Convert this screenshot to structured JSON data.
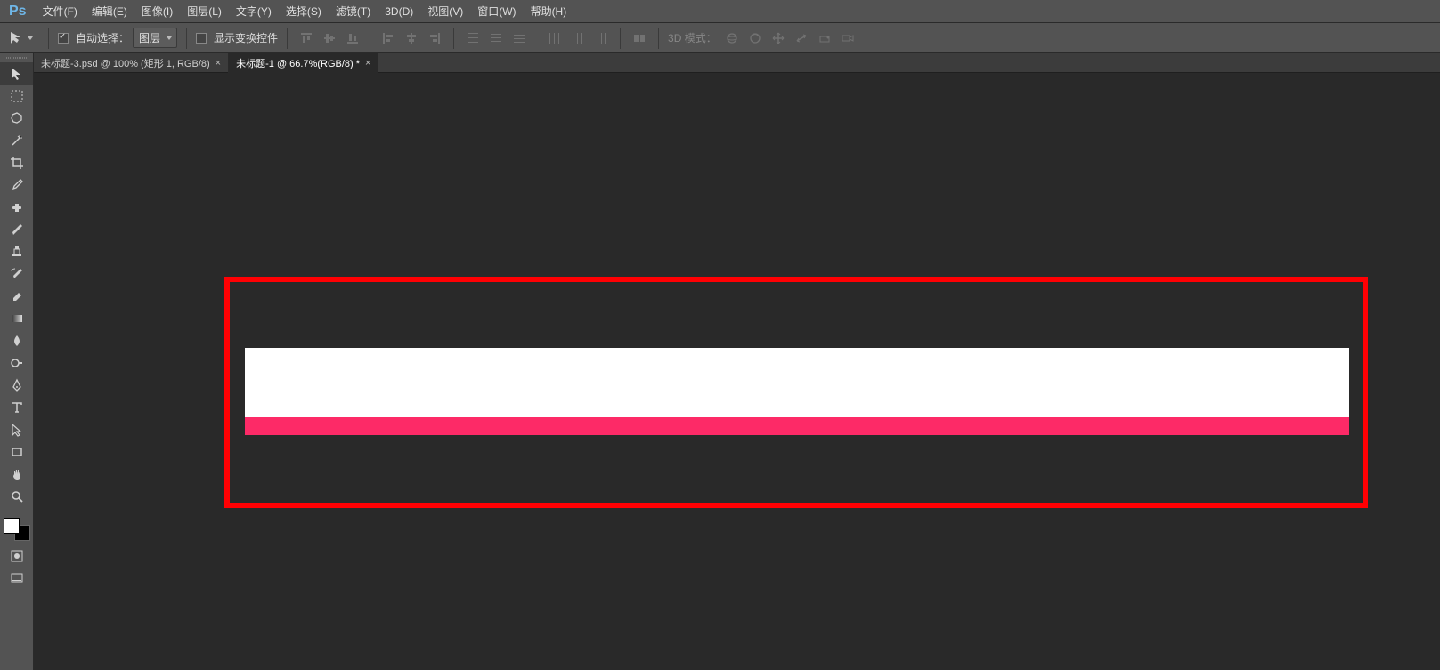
{
  "app": {
    "logo": "Ps"
  },
  "menu": {
    "items": [
      {
        "label": "文件(F)"
      },
      {
        "label": "编辑(E)"
      },
      {
        "label": "图像(I)"
      },
      {
        "label": "图层(L)"
      },
      {
        "label": "文字(Y)"
      },
      {
        "label": "选择(S)"
      },
      {
        "label": "滤镜(T)"
      },
      {
        "label": "3D(D)"
      },
      {
        "label": "视图(V)"
      },
      {
        "label": "窗口(W)"
      },
      {
        "label": "帮助(H)"
      }
    ]
  },
  "options": {
    "auto_select_label": "自动选择：",
    "auto_select_dropdown": "图层",
    "show_transform_label": "显示变换控件",
    "mode_3d_label": "3D 模式："
  },
  "tabs": {
    "items": [
      {
        "label": "未标题-3.psd @ 100% (矩形 1, RGB/8)",
        "close": "×"
      },
      {
        "label": "未标题-1 @ 66.7%(RGB/8) *",
        "close": "×"
      }
    ]
  },
  "colors": {
    "annotation_border": "#ff0003",
    "pink_strip": "#fd2a67",
    "canvas_bg": "#292929"
  }
}
